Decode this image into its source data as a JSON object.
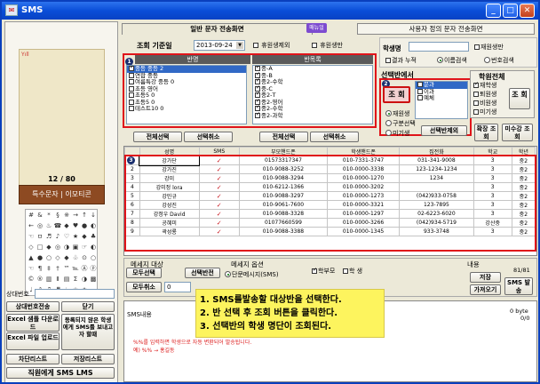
{
  "window": {
    "title": "SMS"
  },
  "phone": {
    "signal": "Yıll",
    "counter": "12 / 80",
    "bottom_label": "특수문자 | 이모티콘",
    "keys": [
      "#",
      "&",
      "*",
      "§",
      "※",
      "→",
      "↑",
      "↓",
      "←",
      "◎",
      "♨",
      "☎",
      "◆",
      "♥",
      "●",
      "◐",
      "☜",
      "ㅁ",
      "♬",
      "♪",
      "♡",
      "★",
      "◆",
      "♣",
      "◇",
      "□",
      "◆",
      "◎",
      "◑",
      "▣",
      "☞",
      "◐",
      "▲",
      "●",
      "○",
      "◇",
      "◆",
      "♧",
      "⊙",
      "○",
      "☜",
      "¶",
      "‡",
      "†",
      "™",
      "℡",
      "Ⓐ",
      "ⓟ",
      "©",
      "®",
      "▥",
      "Ⅱ",
      "▤",
      "Σ",
      "◑",
      "▩",
      "♩",
      "♪",
      "♫",
      "♬",
      "♭",
      "☆",
      "★"
    ],
    "sender_label": "상대번호",
    "buttons": {
      "sender_send": "상대번호전송",
      "close": "닫기",
      "excel_sample": "Excel 샘플 다운로드",
      "excel_upload": "Excel 파일 업로드",
      "unregistered": "등록되지 않은 학생에게 SMS를 보내고자 할때",
      "block_list": "차단리스트",
      "save_list": "저장리스트",
      "staff_sms": "직원에게 SMS LMS"
    }
  },
  "tabs": {
    "general": "일반 문자 전송화면",
    "manual": "매뉴얼",
    "custom": "사용자 정의 문자 전송화면"
  },
  "query": {
    "base_date_label": "조회 기준일",
    "base_date": "2013-09-24",
    "exclude_leave": "휴원생제외",
    "leave_only": "휴원생만"
  },
  "classes": {
    "header": "반명",
    "items": [
      "중등 중등 2",
      "연합 중등",
      "여름특강 중등 0",
      "초등 영어",
      "초등5 0",
      "초등5 0",
      "테스트10 0"
    ],
    "checked": [
      true,
      false,
      false,
      false,
      false,
      false,
      false
    ]
  },
  "groups": {
    "header": "반목록",
    "items": [
      "중-A",
      "중-B",
      "중2-수학",
      "중-C",
      "중2-T",
      "중2-영어",
      "중2-수학",
      "중2-과학"
    ]
  },
  "select_all_1": "전체선택",
  "deselect_1": "선택취소",
  "select_all_2": "전체선택",
  "deselect_2": "선택취소",
  "search": {
    "student_label": "학생명",
    "enrolled": "재원생만",
    "result_cumulative": "결과 누적",
    "by_name": "이름검색",
    "by_phone": "번호검색"
  },
  "class_filter": {
    "title": "선택반에서",
    "query_button": "조 회",
    "list": [
      "문과",
      "이과",
      "예체"
    ],
    "enrolled": "재원생",
    "section_select": "구분선택",
    "graduated": "미기생",
    "excl_button": "선택반제외"
  },
  "academy": {
    "title": "학원전체",
    "enrolled": "재학생",
    "withdrawn": "퇴원생",
    "non_enrolled": "비원생",
    "unassigned": "미기생",
    "query_button": "조 회"
  },
  "confirm_query": "확장 조회",
  "unconfirmed": "미수강 조회",
  "grid": {
    "headers": [
      "",
      "성명",
      "SMS",
      "부모핸드폰",
      "학생핸드폰",
      "집전화",
      "학교",
      "학년"
    ],
    "rows": [
      [
        "1",
        "강가단",
        "✓",
        "01573317347",
        "010-7331-3747",
        "031-341-9008",
        "3",
        "중2"
      ],
      [
        "2",
        "강가진",
        "✓",
        "010-9088-3252",
        "010-0000-3338",
        "123-1234-1234",
        "3",
        "중2"
      ],
      [
        "3",
        "강미",
        "✓",
        "010-9088-3294",
        "010-0000-1270",
        "1234",
        "3",
        "중2"
      ],
      [
        "4",
        "강미정 lora",
        "✓",
        "010-6212-1366",
        "010-0000-3202",
        "",
        "3",
        "중2"
      ],
      [
        "5",
        "강민규",
        "✓",
        "010-9088-3297",
        "010-0000-1273",
        "(042)933-0758",
        "3",
        "중2"
      ],
      [
        "6",
        "강성진",
        "✓",
        "010-9061-7600",
        "010-0000-3321",
        "123-7895",
        "3",
        "중2"
      ],
      [
        "7",
        "강정우 David",
        "✓",
        "010-9088-3328",
        "010-0000-1297",
        "02-6223-6020",
        "3",
        "중2"
      ],
      [
        "8",
        "공혜미",
        "✓",
        "01077660599",
        "010-0000-3266",
        "(042)934-5719",
        "강산중",
        "중2"
      ],
      [
        "9",
        "곽성룡",
        "✓",
        "010-9088-3388",
        "010-0000-1345",
        "933-3748",
        "3",
        "중2"
      ]
    ]
  },
  "bottom": {
    "target_title": "메세지 대상",
    "all_select": "모두선택",
    "selected_class": "선택반전",
    "deselect_all": "모두취소",
    "zero": "0",
    "options_title": "메세지 옵션",
    "single_sms": "단문메시지(SMS)",
    "parent": "학부모",
    "student": "학 생",
    "content_title": "내용",
    "sms_title": "SMS내용",
    "counter": "81/81",
    "save": "저장",
    "send": "SMS 발송",
    "bring": "가져오기",
    "byte": "0 byte",
    "fraction": "0/0",
    "warning1": "%%를 입력하면 학생으로 자동 변환되어 발송됩니다.",
    "warning2": "예) %% → 홍길동"
  },
  "instructions": [
    "1. SMS를발송할 대상반을 선택한다.",
    "2. 반 선택 후 조회 버튼을 클릭한다.",
    "3. 선택반의 학생 명단이 조회된다."
  ],
  "colors": {
    "red": "#e0141a",
    "titlebar": "#0a4ed8",
    "instruction_bg": "#fdf45e"
  }
}
